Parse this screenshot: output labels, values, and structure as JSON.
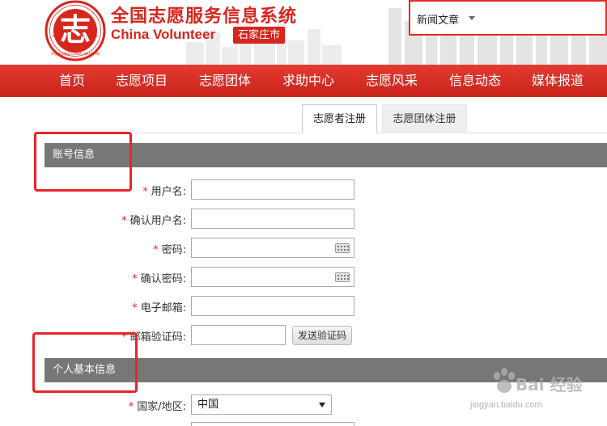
{
  "header": {
    "logo_ring_text": "中国志愿服务 CHINA VOLUNTEER SERVICE",
    "logo_glyph": "志",
    "title_cn": "全国志愿服务信息系统",
    "title_en": "China Volunteer",
    "city": "石家庄市",
    "search_select": "新闻文章"
  },
  "nav": {
    "items": [
      {
        "label": "首页"
      },
      {
        "label": "志愿项目"
      },
      {
        "label": "志愿团体"
      },
      {
        "label": "求助中心"
      },
      {
        "label": "志愿风采"
      },
      {
        "label": "信息动态"
      },
      {
        "label": "媒体报道"
      }
    ]
  },
  "tabs": [
    {
      "label": "志愿者注册",
      "active": true
    },
    {
      "label": "志愿团体注册",
      "active": false
    }
  ],
  "sections": {
    "account": "账号信息",
    "personal": "个人基本信息"
  },
  "form": {
    "required_mark": "*",
    "username": {
      "label": "用户名:",
      "value": ""
    },
    "confirm_username": {
      "label": "确认用户名:",
      "value": ""
    },
    "password": {
      "label": "密码:",
      "value": ""
    },
    "confirm_password": {
      "label": "确认密码:",
      "value": ""
    },
    "email": {
      "label": "电子邮箱:",
      "value": ""
    },
    "email_code": {
      "label": "邮箱验证码:",
      "value": "",
      "button": "发送验证码"
    },
    "country": {
      "label": "国家/地区:",
      "value": "中国"
    }
  },
  "watermark": {
    "text": "Bai 经验",
    "url": "jingyan.baidu.com"
  },
  "colors": {
    "brand_red": "#d7261e",
    "annotation_red": "#e8242a",
    "section_gray": "#777777"
  }
}
